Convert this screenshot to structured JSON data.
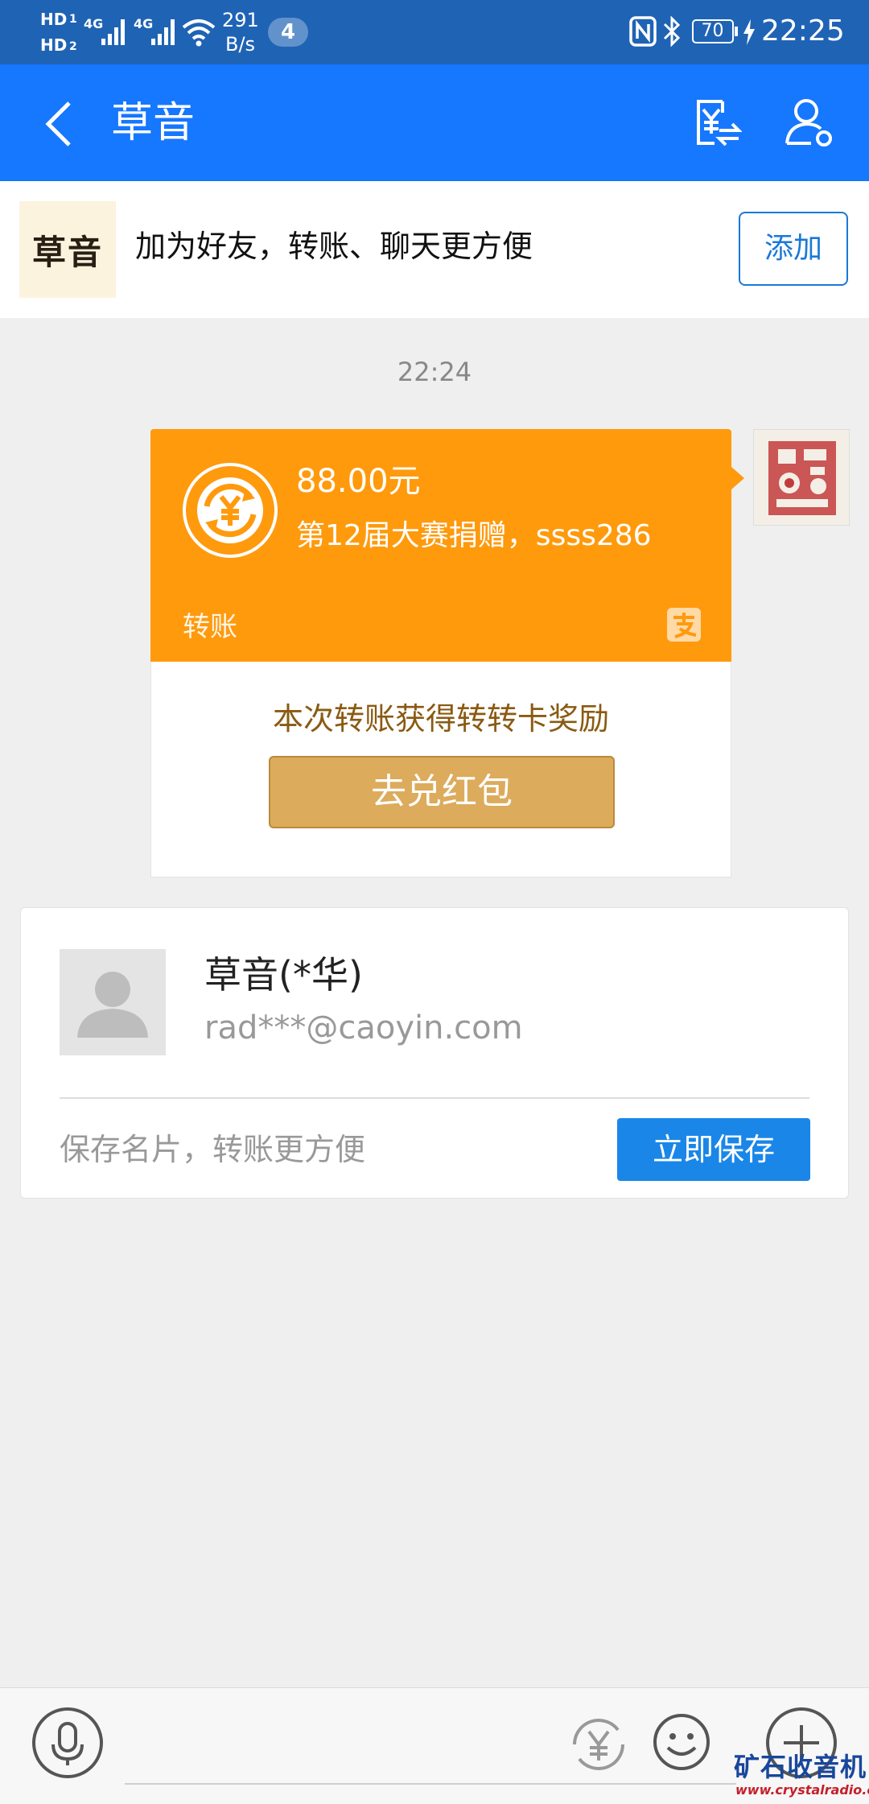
{
  "status_bar": {
    "hd1": "HD",
    "hd2": "HD",
    "net1": "4G",
    "net2": "4G",
    "speed": "291",
    "speed_unit": "B/s",
    "notification_count": "4",
    "battery": "70",
    "time": "22:25"
  },
  "header": {
    "title": "草音",
    "back_icon": "chevron-left-icon",
    "transfer_icon": "yuan-transfer-icon",
    "profile_icon": "user-settings-icon"
  },
  "add_friend_bar": {
    "logo_text": "草音",
    "text": "加为好友，转账、聊天更方便",
    "button": "添加"
  },
  "chat": {
    "timestamp": "22:24",
    "transfer": {
      "amount": "88.00元",
      "memo": "第12届大赛捐赠，ssss286",
      "type_label": "转账",
      "reward_text": "本次转账获得转转卡奖励",
      "reward_button": "去兑红包"
    }
  },
  "contact_card": {
    "name": "草音(*华)",
    "email": "rad***@caoyin.com",
    "hint": "保存名片，转账更方便",
    "save_button": "立即保存"
  },
  "bottom_bar": {
    "icons": [
      "microphone-icon",
      "yuan-icon",
      "emoji-icon",
      "plus-icon"
    ]
  },
  "watermark": {
    "main": "矿石收音机",
    "url": "www.crystalradio.cn"
  },
  "colors": {
    "status_bar": "#1f63b5",
    "header": "#1677ff",
    "transfer_card": "#ff9a0d",
    "reward_button": "#dcab5c",
    "save_button": "#1a86e8"
  }
}
